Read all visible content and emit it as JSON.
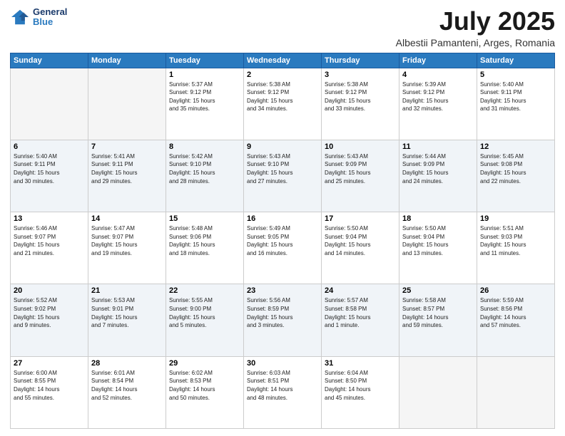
{
  "header": {
    "logo_line1": "General",
    "logo_line2": "Blue",
    "title": "July 2025",
    "subtitle": "Albestii Pamanteni, Arges, Romania"
  },
  "columns": [
    "Sunday",
    "Monday",
    "Tuesday",
    "Wednesday",
    "Thursday",
    "Friday",
    "Saturday"
  ],
  "rows": [
    [
      {
        "day": "",
        "info": ""
      },
      {
        "day": "",
        "info": ""
      },
      {
        "day": "1",
        "info": "Sunrise: 5:37 AM\nSunset: 9:12 PM\nDaylight: 15 hours\nand 35 minutes."
      },
      {
        "day": "2",
        "info": "Sunrise: 5:38 AM\nSunset: 9:12 PM\nDaylight: 15 hours\nand 34 minutes."
      },
      {
        "day": "3",
        "info": "Sunrise: 5:38 AM\nSunset: 9:12 PM\nDaylight: 15 hours\nand 33 minutes."
      },
      {
        "day": "4",
        "info": "Sunrise: 5:39 AM\nSunset: 9:12 PM\nDaylight: 15 hours\nand 32 minutes."
      },
      {
        "day": "5",
        "info": "Sunrise: 5:40 AM\nSunset: 9:11 PM\nDaylight: 15 hours\nand 31 minutes."
      }
    ],
    [
      {
        "day": "6",
        "info": "Sunrise: 5:40 AM\nSunset: 9:11 PM\nDaylight: 15 hours\nand 30 minutes."
      },
      {
        "day": "7",
        "info": "Sunrise: 5:41 AM\nSunset: 9:11 PM\nDaylight: 15 hours\nand 29 minutes."
      },
      {
        "day": "8",
        "info": "Sunrise: 5:42 AM\nSunset: 9:10 PM\nDaylight: 15 hours\nand 28 minutes."
      },
      {
        "day": "9",
        "info": "Sunrise: 5:43 AM\nSunset: 9:10 PM\nDaylight: 15 hours\nand 27 minutes."
      },
      {
        "day": "10",
        "info": "Sunrise: 5:43 AM\nSunset: 9:09 PM\nDaylight: 15 hours\nand 25 minutes."
      },
      {
        "day": "11",
        "info": "Sunrise: 5:44 AM\nSunset: 9:09 PM\nDaylight: 15 hours\nand 24 minutes."
      },
      {
        "day": "12",
        "info": "Sunrise: 5:45 AM\nSunset: 9:08 PM\nDaylight: 15 hours\nand 22 minutes."
      }
    ],
    [
      {
        "day": "13",
        "info": "Sunrise: 5:46 AM\nSunset: 9:07 PM\nDaylight: 15 hours\nand 21 minutes."
      },
      {
        "day": "14",
        "info": "Sunrise: 5:47 AM\nSunset: 9:07 PM\nDaylight: 15 hours\nand 19 minutes."
      },
      {
        "day": "15",
        "info": "Sunrise: 5:48 AM\nSunset: 9:06 PM\nDaylight: 15 hours\nand 18 minutes."
      },
      {
        "day": "16",
        "info": "Sunrise: 5:49 AM\nSunset: 9:05 PM\nDaylight: 15 hours\nand 16 minutes."
      },
      {
        "day": "17",
        "info": "Sunrise: 5:50 AM\nSunset: 9:04 PM\nDaylight: 15 hours\nand 14 minutes."
      },
      {
        "day": "18",
        "info": "Sunrise: 5:50 AM\nSunset: 9:04 PM\nDaylight: 15 hours\nand 13 minutes."
      },
      {
        "day": "19",
        "info": "Sunrise: 5:51 AM\nSunset: 9:03 PM\nDaylight: 15 hours\nand 11 minutes."
      }
    ],
    [
      {
        "day": "20",
        "info": "Sunrise: 5:52 AM\nSunset: 9:02 PM\nDaylight: 15 hours\nand 9 minutes."
      },
      {
        "day": "21",
        "info": "Sunrise: 5:53 AM\nSunset: 9:01 PM\nDaylight: 15 hours\nand 7 minutes."
      },
      {
        "day": "22",
        "info": "Sunrise: 5:55 AM\nSunset: 9:00 PM\nDaylight: 15 hours\nand 5 minutes."
      },
      {
        "day": "23",
        "info": "Sunrise: 5:56 AM\nSunset: 8:59 PM\nDaylight: 15 hours\nand 3 minutes."
      },
      {
        "day": "24",
        "info": "Sunrise: 5:57 AM\nSunset: 8:58 PM\nDaylight: 15 hours\nand 1 minute."
      },
      {
        "day": "25",
        "info": "Sunrise: 5:58 AM\nSunset: 8:57 PM\nDaylight: 14 hours\nand 59 minutes."
      },
      {
        "day": "26",
        "info": "Sunrise: 5:59 AM\nSunset: 8:56 PM\nDaylight: 14 hours\nand 57 minutes."
      }
    ],
    [
      {
        "day": "27",
        "info": "Sunrise: 6:00 AM\nSunset: 8:55 PM\nDaylight: 14 hours\nand 55 minutes."
      },
      {
        "day": "28",
        "info": "Sunrise: 6:01 AM\nSunset: 8:54 PM\nDaylight: 14 hours\nand 52 minutes."
      },
      {
        "day": "29",
        "info": "Sunrise: 6:02 AM\nSunset: 8:53 PM\nDaylight: 14 hours\nand 50 minutes."
      },
      {
        "day": "30",
        "info": "Sunrise: 6:03 AM\nSunset: 8:51 PM\nDaylight: 14 hours\nand 48 minutes."
      },
      {
        "day": "31",
        "info": "Sunrise: 6:04 AM\nSunset: 8:50 PM\nDaylight: 14 hours\nand 45 minutes."
      },
      {
        "day": "",
        "info": ""
      },
      {
        "day": "",
        "info": ""
      }
    ]
  ]
}
